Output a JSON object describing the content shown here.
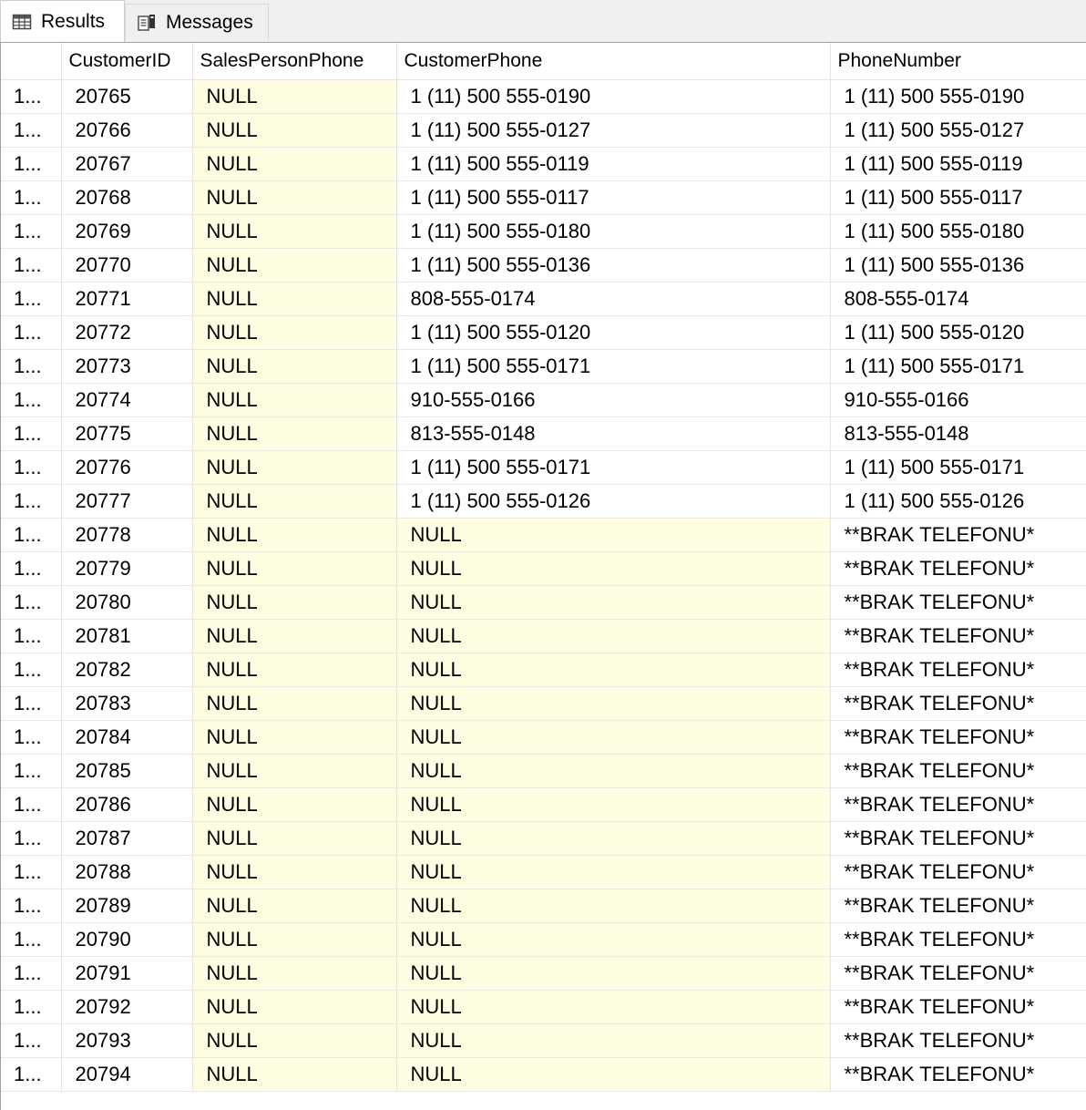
{
  "tabs": {
    "results_label": "Results",
    "messages_label": "Messages"
  },
  "grid": {
    "columns": [
      "",
      "CustomerID",
      "SalesPersonPhone",
      "CustomerPhone",
      "PhoneNumber"
    ],
    "rows": [
      [
        "1...",
        "20765",
        "NULL",
        "1 (11) 500 555-0190",
        "1 (11) 500 555-0190"
      ],
      [
        "1...",
        "20766",
        "NULL",
        "1 (11) 500 555-0127",
        "1 (11) 500 555-0127"
      ],
      [
        "1...",
        "20767",
        "NULL",
        "1 (11) 500 555-0119",
        "1 (11) 500 555-0119"
      ],
      [
        "1...",
        "20768",
        "NULL",
        "1 (11) 500 555-0117",
        "1 (11) 500 555-0117"
      ],
      [
        "1...",
        "20769",
        "NULL",
        "1 (11) 500 555-0180",
        "1 (11) 500 555-0180"
      ],
      [
        "1...",
        "20770",
        "NULL",
        "1 (11) 500 555-0136",
        "1 (11) 500 555-0136"
      ],
      [
        "1...",
        "20771",
        "NULL",
        "808-555-0174",
        "808-555-0174"
      ],
      [
        "1...",
        "20772",
        "NULL",
        "1 (11) 500 555-0120",
        "1 (11) 500 555-0120"
      ],
      [
        "1...",
        "20773",
        "NULL",
        "1 (11) 500 555-0171",
        "1 (11) 500 555-0171"
      ],
      [
        "1...",
        "20774",
        "NULL",
        "910-555-0166",
        "910-555-0166"
      ],
      [
        "1...",
        "20775",
        "NULL",
        "813-555-0148",
        "813-555-0148"
      ],
      [
        "1...",
        "20776",
        "NULL",
        "1 (11) 500 555-0171",
        "1 (11) 500 555-0171"
      ],
      [
        "1...",
        "20777",
        "NULL",
        "1 (11) 500 555-0126",
        "1 (11) 500 555-0126"
      ],
      [
        "1...",
        "20778",
        "NULL",
        "NULL",
        "**BRAK TELEFONU*"
      ],
      [
        "1...",
        "20779",
        "NULL",
        "NULL",
        "**BRAK TELEFONU*"
      ],
      [
        "1...",
        "20780",
        "NULL",
        "NULL",
        "**BRAK TELEFONU*"
      ],
      [
        "1...",
        "20781",
        "NULL",
        "NULL",
        "**BRAK TELEFONU*"
      ],
      [
        "1...",
        "20782",
        "NULL",
        "NULL",
        "**BRAK TELEFONU*"
      ],
      [
        "1...",
        "20783",
        "NULL",
        "NULL",
        "**BRAK TELEFONU*"
      ],
      [
        "1...",
        "20784",
        "NULL",
        "NULL",
        "**BRAK TELEFONU*"
      ],
      [
        "1...",
        "20785",
        "NULL",
        "NULL",
        "**BRAK TELEFONU*"
      ],
      [
        "1...",
        "20786",
        "NULL",
        "NULL",
        "**BRAK TELEFONU*"
      ],
      [
        "1...",
        "20787",
        "NULL",
        "NULL",
        "**BRAK TELEFONU*"
      ],
      [
        "1...",
        "20788",
        "NULL",
        "NULL",
        "**BRAK TELEFONU*"
      ],
      [
        "1...",
        "20789",
        "NULL",
        "NULL",
        "**BRAK TELEFONU*"
      ],
      [
        "1...",
        "20790",
        "NULL",
        "NULL",
        "**BRAK TELEFONU*"
      ],
      [
        "1...",
        "20791",
        "NULL",
        "NULL",
        "**BRAK TELEFONU*"
      ],
      [
        "1...",
        "20792",
        "NULL",
        "NULL",
        "**BRAK TELEFONU*"
      ],
      [
        "1...",
        "20793",
        "NULL",
        "NULL",
        "**BRAK TELEFONU*"
      ],
      [
        "1...",
        "20794",
        "NULL",
        "NULL",
        "**BRAK TELEFONU*"
      ]
    ]
  },
  "colors": {
    "null_cell_bg": "#fffde1",
    "tabbar_bg": "#f0f0f0"
  },
  "icons": {
    "results": "grid-icon",
    "messages": "messages-icon"
  }
}
